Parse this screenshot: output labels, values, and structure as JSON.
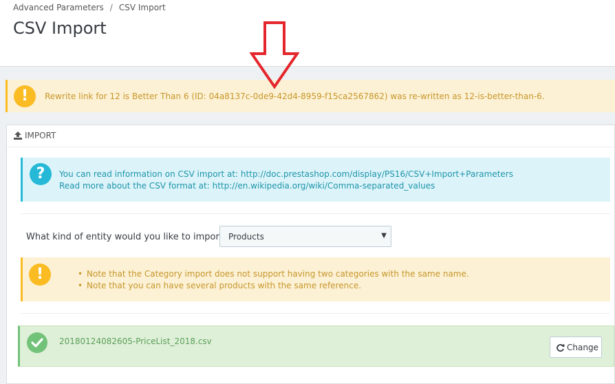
{
  "breadcrumb": {
    "parent": "Advanced Parameters",
    "separator": "/",
    "current": "CSV Import"
  },
  "page_title": "CSV Import",
  "top_alert": {
    "icon": "exclamation-icon",
    "text": "Rewrite link for 12 is Better Than 6 (ID: 04a8137c-0de9-42d4-8959-f15ca2567862) was re-written as 12-is-better-than-6."
  },
  "panel": {
    "icon": "upload-icon",
    "title": "IMPORT",
    "info": {
      "icon": "question-icon",
      "line1_prefix": "You can read information on CSV import at: ",
      "line1_link": "http://doc.prestashop.com/display/PS16/CSV+Import+Parameters",
      "line2_prefix": "Read more about the CSV format at: ",
      "line2_link": "http://en.wikipedia.org/wiki/Comma-separated_values"
    },
    "entity": {
      "label": "What kind of entity would you like to import?",
      "selected": "Products"
    },
    "notes": [
      "Note that the Category import does not support having two categories with the same name.",
      "Note that you can have several products with the same reference."
    ],
    "file": {
      "name": "20180124082605-PriceList_2018.csv",
      "change_label": "Change"
    }
  },
  "colors": {
    "warning": "#fbbb22",
    "info": "#25b9d7",
    "success": "#72c279",
    "annotation_arrow": "#e4262c"
  }
}
